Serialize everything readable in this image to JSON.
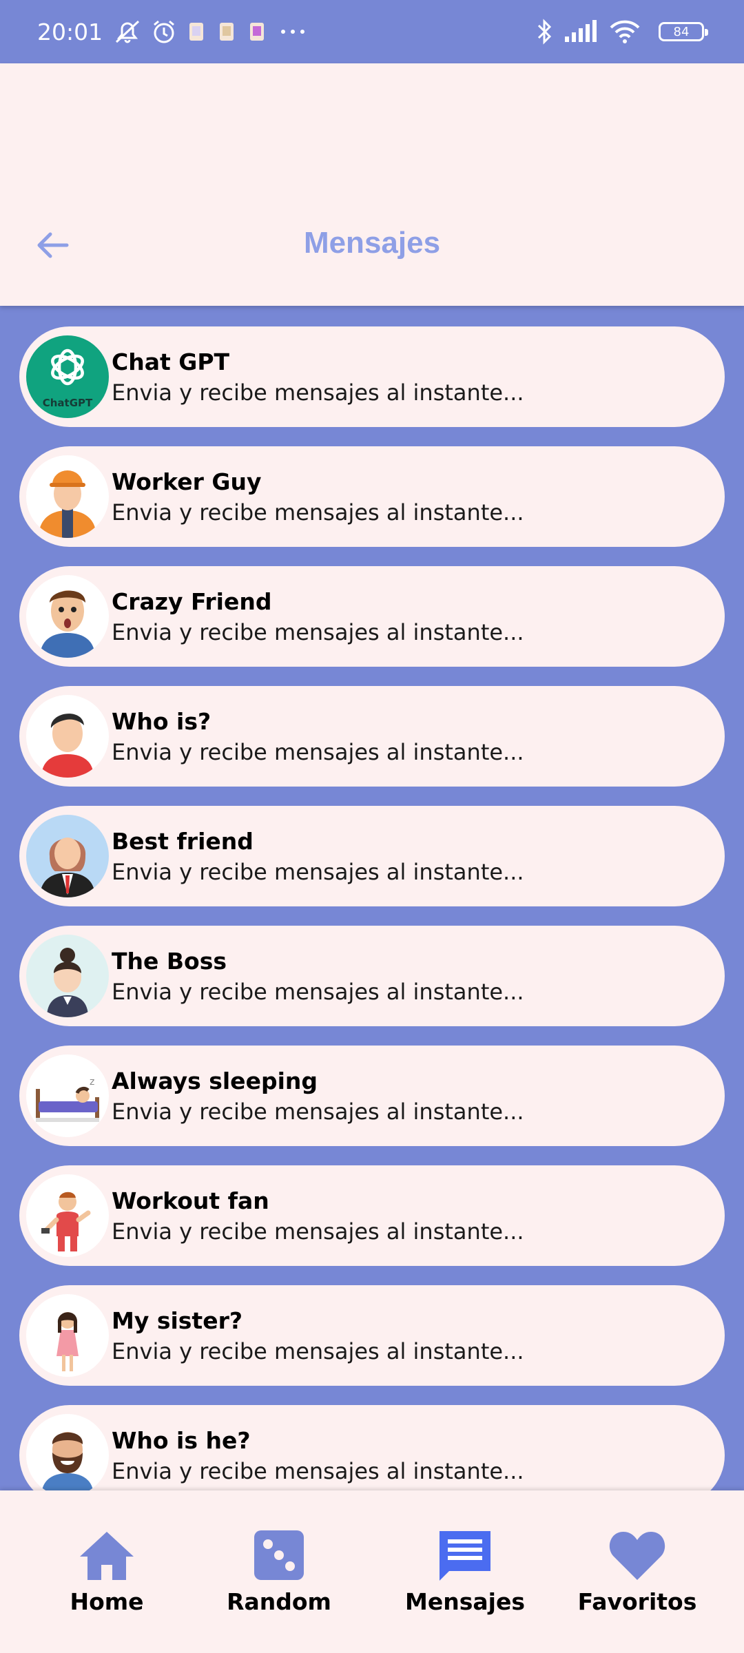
{
  "status_bar": {
    "time": "20:01",
    "battery": "84",
    "icons": [
      "mute-icon",
      "alarm-icon",
      "app-icon",
      "app-icon",
      "app-icon",
      "more-dots-icon",
      "bluetooth-icon",
      "signal-icon",
      "wifi-icon",
      "battery-icon"
    ]
  },
  "header": {
    "title": "Mensajes",
    "back_icon": "arrow-left-icon"
  },
  "chats": [
    {
      "name": "Chat GPT",
      "preview": "Envia y recibe mensajes al instante...",
      "avatar": "chatgpt-logo",
      "avatar_label": "ChatGPT"
    },
    {
      "name": "Worker Guy",
      "preview": "Envia y recibe mensajes al instante...",
      "avatar": "worker-avatar"
    },
    {
      "name": "Crazy Friend",
      "preview": "Envia y recibe mensajes al instante...",
      "avatar": "surprised-man-avatar"
    },
    {
      "name": "Who is?",
      "preview": "Envia y recibe mensajes al instante...",
      "avatar": "man-avatar"
    },
    {
      "name": "Best friend",
      "preview": "Envia y recibe mensajes al instante...",
      "avatar": "woman-avatar"
    },
    {
      "name": "The Boss",
      "preview": "Envia y recibe mensajes al instante...",
      "avatar": "boss-avatar"
    },
    {
      "name": "Always sleeping",
      "preview": "Envia y recibe mensajes al instante...",
      "avatar": "sleeping-avatar"
    },
    {
      "name": "Workout fan",
      "preview": "Envia y recibe mensajes al instante...",
      "avatar": "workout-avatar"
    },
    {
      "name": "My sister?",
      "preview": "Envia y recibe mensajes al instante...",
      "avatar": "girl-avatar"
    },
    {
      "name": "Who is he?",
      "preview": "Envia y recibe mensajes al instante...",
      "avatar": "bearded-man-avatar"
    }
  ],
  "nav": {
    "home": "Home",
    "random": "Random",
    "messages": "Mensajes",
    "favorites": "Favoritos"
  },
  "colors": {
    "primary": "#7787d5",
    "surface": "#fdf0f0",
    "title": "#8e9fe6",
    "chatgpt": "#10a37f"
  }
}
